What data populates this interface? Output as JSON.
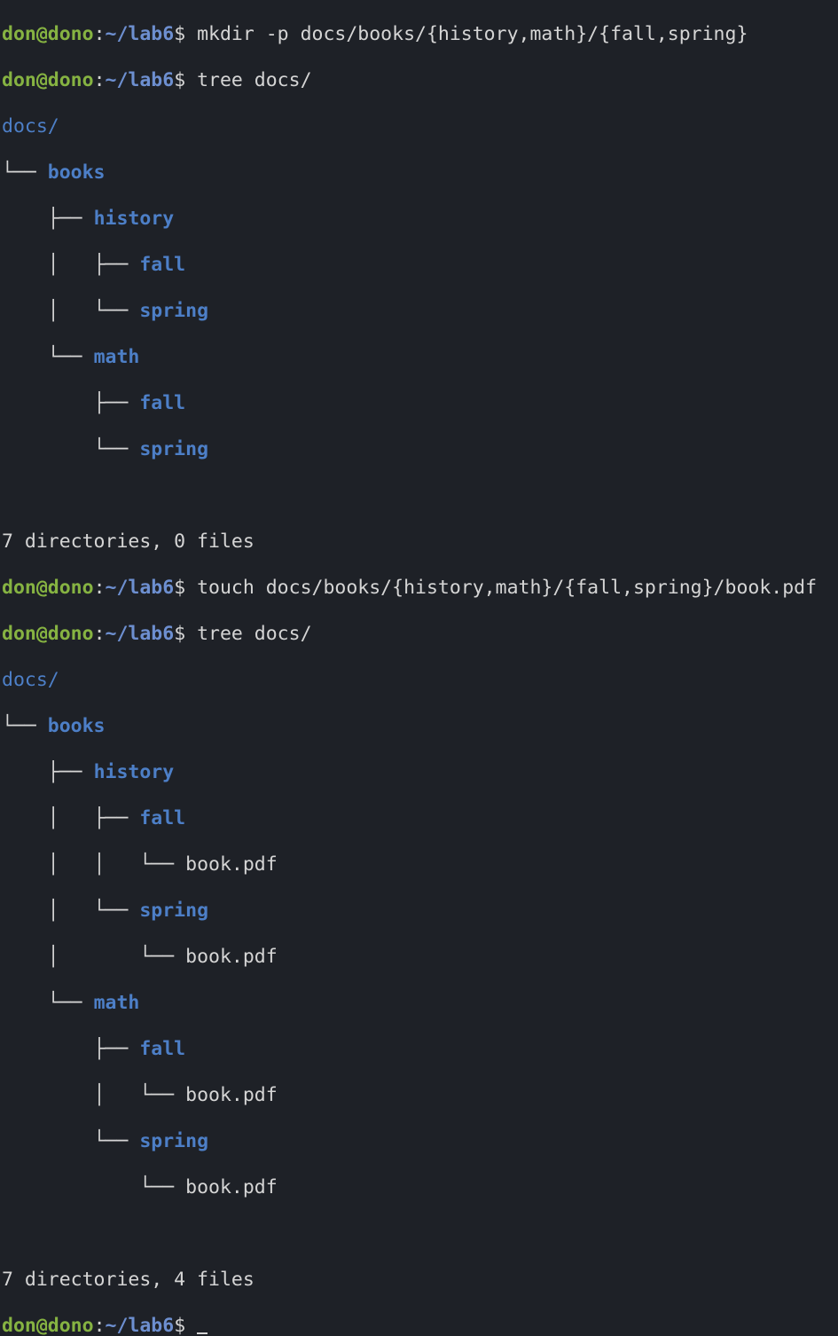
{
  "prompt": {
    "user": "don@dono",
    "sep": ":",
    "path": "~/lab6",
    "symbol": "$ "
  },
  "commands": {
    "mkdir": "mkdir -p docs/books/{history,math}/{fall,spring}",
    "tree1": "tree docs/",
    "touch": "touch docs/books/{history,math}/{fall,spring}/book.pdf",
    "tree2": "tree docs/"
  },
  "tree": {
    "root": "docs/",
    "books": "books",
    "history": "history",
    "math": "math",
    "fall": "fall",
    "spring": "spring",
    "file": "book.pdf"
  },
  "branches": {
    "last": "└── ",
    "mid": "├── ",
    "pipe": "│   ",
    "space": "    "
  },
  "summaries": {
    "first": "7 directories, 0 files",
    "second": "7 directories, 4 files"
  },
  "colors": {
    "background": "#1e2127",
    "user": "#86b342",
    "path": "#6d8fd0",
    "directory": "#4d7fc7",
    "text": "#d5d5d5"
  }
}
